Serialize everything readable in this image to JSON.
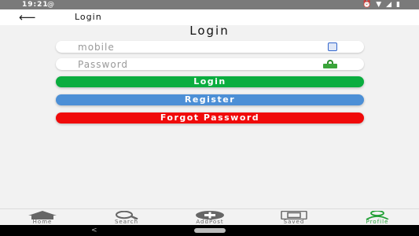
{
  "status_bar": {
    "time": "19:21",
    "at_symbol": "@"
  },
  "app_bar": {
    "title": "Login"
  },
  "page": {
    "heading": "Login"
  },
  "form": {
    "mobile_placeholder": "mobile",
    "password_placeholder": "Password",
    "login_label": "Login",
    "register_label": "Register",
    "forgot_label": "Forgot Password"
  },
  "bottom_nav": {
    "items": [
      {
        "label": "Home",
        "icon": "home-icon",
        "active": false
      },
      {
        "label": "Search",
        "icon": "search-icon",
        "active": false
      },
      {
        "label": "AddPost",
        "icon": "add-circle-icon",
        "active": false
      },
      {
        "label": "Saved",
        "icon": "saved-icon",
        "active": false
      },
      {
        "label": "Profile",
        "icon": "profile-icon",
        "active": true
      }
    ]
  },
  "colors": {
    "login": "#0aad3f",
    "register": "#4c8fd6",
    "forgot": "#f00a0a",
    "active_nav": "#22a036",
    "status_bar": "#7a7a7a"
  }
}
